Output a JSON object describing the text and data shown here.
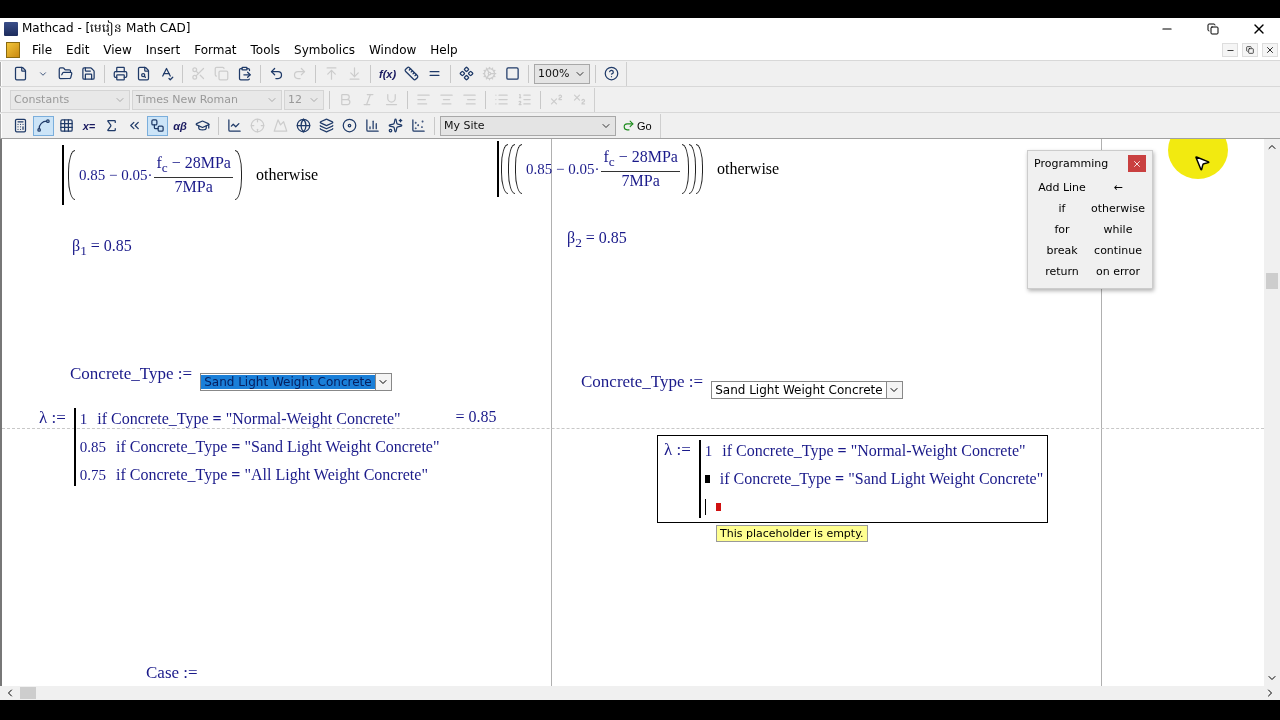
{
  "window": {
    "title": "Mathcad - [មេរៀន Math CAD]"
  },
  "menu": [
    "File",
    "Edit",
    "View",
    "Insert",
    "Format",
    "Tools",
    "Symbolics",
    "Window",
    "Help"
  ],
  "standard_toolbar": [
    {
      "kind": "File",
      "disabled": false
    },
    {
      "kind": "ChevronDown",
      "disabled": false
    },
    {
      "kind": "FolderOpen",
      "disabled": false
    },
    {
      "kind": "Save",
      "disabled": false
    },
    {
      "kind": "sep"
    },
    {
      "kind": "Printer",
      "disabled": false
    },
    {
      "kind": "FileSearch",
      "disabled": false
    },
    {
      "kind": "SpellCheck",
      "disabled": false
    },
    {
      "kind": "sep"
    },
    {
      "kind": "Scissors",
      "disabled": true
    },
    {
      "kind": "Copy",
      "disabled": true
    },
    {
      "kind": "ClipboardPaste",
      "disabled": false
    },
    {
      "kind": "sep"
    },
    {
      "kind": "Undo2",
      "disabled": false
    },
    {
      "kind": "Redo2",
      "disabled": true
    },
    {
      "kind": "sep"
    },
    {
      "kind": "ArrowUpToLine",
      "disabled": true
    },
    {
      "kind": "ArrowDownToLine",
      "disabled": true
    },
    {
      "kind": "sep"
    },
    {
      "kind": "text",
      "label": "f(x)",
      "disabled": false
    },
    {
      "kind": "Ruler",
      "disabled": false
    },
    {
      "kind": "Equal",
      "disabled": false
    },
    {
      "kind": "sep"
    },
    {
      "kind": "Component",
      "disabled": false
    },
    {
      "kind": "Cog",
      "disabled": true
    },
    {
      "kind": "Square",
      "disabled": false
    },
    {
      "kind": "sep"
    },
    {
      "kind": "zoom-combo",
      "label": "100%",
      "disabled": false
    },
    {
      "kind": "sep"
    },
    {
      "kind": "CircleHelp",
      "disabled": false
    }
  ],
  "formatting_toolbar": [
    {
      "kind": "style-combo",
      "label": "Constants",
      "disabled": true
    },
    {
      "kind": "font-combo",
      "label": "Times New Roman",
      "disabled": true
    },
    {
      "kind": "size-combo",
      "label": "12",
      "disabled": true
    },
    {
      "kind": "sep"
    },
    {
      "kind": "Bold",
      "disabled": true
    },
    {
      "kind": "Italic",
      "disabled": true
    },
    {
      "kind": "Underline",
      "disabled": true
    },
    {
      "kind": "sep"
    },
    {
      "kind": "AlignLeft",
      "disabled": true
    },
    {
      "kind": "AlignCenter",
      "disabled": true
    },
    {
      "kind": "AlignRight",
      "disabled": true
    },
    {
      "kind": "sep"
    },
    {
      "kind": "List",
      "disabled": true
    },
    {
      "kind": "ListOrdered",
      "disabled": true
    },
    {
      "kind": "sep"
    },
    {
      "kind": "Superscript",
      "disabled": true
    },
    {
      "kind": "Subscript",
      "disabled": true
    }
  ],
  "math_toolbar": [
    {
      "kind": "Calculator",
      "disabled": false,
      "pressed": false
    },
    {
      "kind": "Spline",
      "disabled": false,
      "pressed": true
    },
    {
      "kind": "Grid3x3",
      "disabled": false,
      "pressed": false
    },
    {
      "kind": "text",
      "label": "x=",
      "disabled": false,
      "pressed": false
    },
    {
      "kind": "Sigma",
      "disabled": false,
      "pressed": false
    },
    {
      "kind": "ChevronsLeft",
      "disabled": false,
      "pressed": false
    },
    {
      "kind": "Workflow",
      "disabled": false,
      "pressed": true
    },
    {
      "kind": "text",
      "label": "αβ",
      "disabled": false,
      "pressed": false
    },
    {
      "kind": "GraduationCap",
      "disabled": false,
      "pressed": false
    },
    {
      "kind": "sep"
    },
    {
      "kind": "ChartLine",
      "disabled": false,
      "pressed": false
    },
    {
      "kind": "Crosshair",
      "disabled": true,
      "pressed": false
    },
    {
      "kind": "Mountain",
      "disabled": true,
      "pressed": false
    },
    {
      "kind": "Globe",
      "disabled": false,
      "pressed": false
    },
    {
      "kind": "Layers",
      "disabled": false,
      "pressed": false
    },
    {
      "kind": "Disc",
      "disabled": false,
      "pressed": false
    },
    {
      "kind": "ChartColumn",
      "disabled": false,
      "pressed": false
    },
    {
      "kind": "Sparkles",
      "disabled": false,
      "pressed": false
    },
    {
      "kind": "ChartScatter",
      "disabled": false,
      "pressed": false
    },
    {
      "kind": "sep"
    },
    {
      "kind": "site-combo",
      "label": "My Site",
      "disabled": false
    },
    {
      "kind": "go",
      "label": "Go"
    }
  ],
  "worksheet": {
    "left_formula": {
      "before": "0.85 − 0.05·",
      "numerator": "f$_{c}$ − 28MPa",
      "denominator": "7MPa",
      "condition": "otherwise",
      "kind": "single"
    },
    "right_formula": {
      "before": "0.85 − 0.05·",
      "numerator": "f$_{c}$ − 28MPa",
      "denominator": "7MPa",
      "condition": "otherwise",
      "kind": "triple"
    },
    "left_result": "β$_{1}$ = 0.85",
    "right_result": "β$_{2}$ = 0.85",
    "left_assignment": {
      "label": "Concrete_Type :=",
      "value": "Sand Light Weight Concrete",
      "selected": true
    },
    "right_assignment": {
      "label": "Concrete_Type :=",
      "value": "Sand Light Weight Concrete",
      "selected": false
    },
    "left_lambda": {
      "label": "λ :=",
      "selected": false,
      "result": "= 0.85",
      "rows": [
        {
          "kind": "value",
          "value": "1",
          "condition": "if  Concrete_Type **=** \"Normal-Weight Concrete\""
        },
        {
          "kind": "value",
          "value": "0.85",
          "condition": "if  Concrete_Type **=** \"Sand Light Weight Concrete\""
        },
        {
          "kind": "value",
          "value": "0.75",
          "condition": "if  Concrete_Type **=** \"All Light Weight Concrete\""
        }
      ]
    },
    "right_lambda": {
      "label": "λ :=",
      "selected": true,
      "rows": [
        {
          "kind": "value",
          "value": "1",
          "condition": "if  Concrete_Type **=** \"Normal-Weight Concrete\""
        },
        {
          "kind": "placeholder",
          "condition": "if  Concrete_Type **=** \"Sand Light Weight Concrete\""
        },
        {
          "kind": "empty"
        }
      ]
    },
    "tooltip": "This placeholder is empty.",
    "case_label": "Case :="
  },
  "programming_panel": {
    "title": "Programming",
    "buttons": [
      "Add Line",
      "←",
      "if",
      "otherwise",
      "for",
      "while",
      "break",
      "continue",
      "return",
      "on error"
    ]
  }
}
